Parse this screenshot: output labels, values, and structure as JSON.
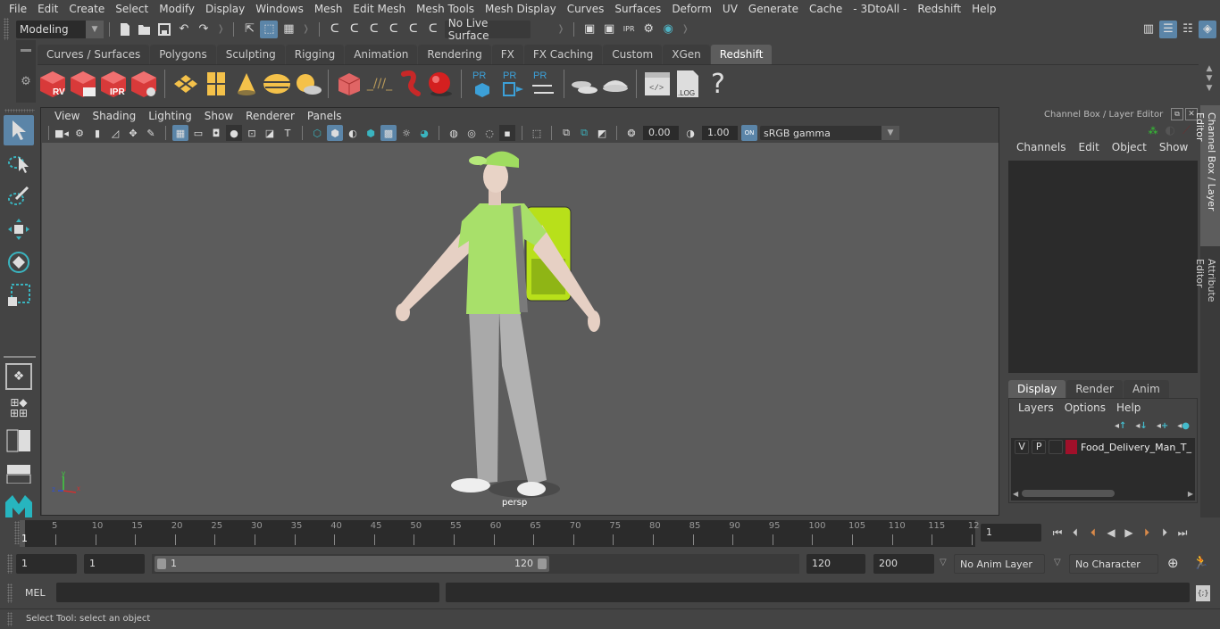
{
  "menubar": {
    "items": [
      "File",
      "Edit",
      "Create",
      "Select",
      "Modify",
      "Display",
      "Windows",
      "Mesh",
      "Edit Mesh",
      "Mesh Tools",
      "Mesh Display",
      "Curves",
      "Surfaces",
      "Deform",
      "UV",
      "Generate",
      "Cache",
      "- 3DtoAll -",
      "Redshift",
      "Help"
    ]
  },
  "statusline": {
    "workspace": "Modeling",
    "live_surface": "No Live Surface"
  },
  "shelf": {
    "tabs": [
      "Curves / Surfaces",
      "Polygons",
      "Sculpting",
      "Rigging",
      "Animation",
      "Rendering",
      "FX",
      "FX Caching",
      "Custom",
      "XGen",
      "Redshift"
    ],
    "active_tab": "Redshift",
    "icons": [
      {
        "name": "rv-render-view-icon",
        "label": "RV"
      },
      {
        "name": "batch-render-icon",
        "label": ""
      },
      {
        "name": "ipr-render-icon",
        "label": "IPR"
      },
      {
        "name": "render-settings-icon",
        "label": ""
      },
      {
        "name": "rect-light-icon",
        "label": ""
      },
      {
        "name": "portal-light-icon",
        "label": ""
      },
      {
        "name": "spot-light-icon",
        "label": ""
      },
      {
        "name": "dome-light-icon",
        "label": ""
      },
      {
        "name": "sun-sky-icon",
        "label": ""
      },
      {
        "name": "proxy-cube-icon",
        "label": ""
      },
      {
        "name": "hair-icon",
        "label": ""
      },
      {
        "name": "volume-icon",
        "label": ""
      },
      {
        "name": "sphere-icon",
        "label": ""
      },
      {
        "name": "pr-create-icon",
        "label": "PR"
      },
      {
        "name": "pr-export-icon",
        "label": "PR"
      },
      {
        "name": "pr-transfer-icon",
        "label": "PR"
      },
      {
        "name": "bake-multi-icon",
        "label": ""
      },
      {
        "name": "bake-icon",
        "label": ""
      },
      {
        "name": "script-editor-icon",
        "label": "</>"
      },
      {
        "name": "log-icon",
        "label": ".LOG"
      },
      {
        "name": "help-icon",
        "label": "?"
      }
    ]
  },
  "viewport": {
    "menu": [
      "View",
      "Shading",
      "Lighting",
      "Show",
      "Renderer",
      "Panels"
    ],
    "exposure": "0.00",
    "gamma": "1.00",
    "color_mgmt": "ON",
    "colorspace": "sRGB gamma",
    "camera_label": "persp",
    "axis": {
      "x": "x",
      "y": "y",
      "z": "z"
    }
  },
  "channel_box": {
    "title": "Channel Box / Layer Editor",
    "menu": [
      "Channels",
      "Edit",
      "Object",
      "Show"
    ]
  },
  "layer_editor": {
    "tabs": [
      "Display",
      "Render",
      "Anim"
    ],
    "active_tab": "Display",
    "menu": [
      "Layers",
      "Options",
      "Help"
    ],
    "layers": [
      {
        "v": "V",
        "p": "P",
        "color": "#a0102a",
        "name": "Food_Delivery_Man_T_"
      }
    ]
  },
  "side_tabs": [
    "Channel Box / Layer Editor",
    "Attribute Editor"
  ],
  "timeline": {
    "ticks": [
      "5",
      "10",
      "15",
      "20",
      "25",
      "30",
      "35",
      "40",
      "45",
      "50",
      "55",
      "60",
      "65",
      "70",
      "75",
      "80",
      "85",
      "90",
      "95",
      "100",
      "105",
      "110",
      "115",
      "12"
    ],
    "current_frame_marker": "1",
    "current_frame": "1"
  },
  "range": {
    "start": "1",
    "playback_start": "1",
    "slider_start": "1",
    "slider_end": "120",
    "playback_end": "120",
    "end": "200",
    "anim_layer": "No Anim Layer",
    "character_set": "No Character Set"
  },
  "command_line": {
    "label": "MEL",
    "value": ""
  },
  "help_line": "Select Tool: select an object"
}
